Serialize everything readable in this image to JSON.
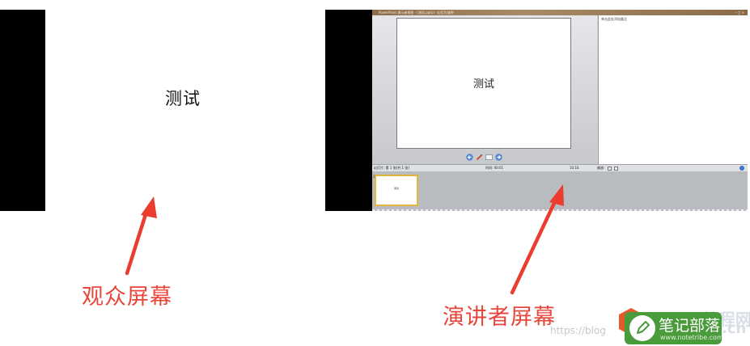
{
  "audience": {
    "slide_title": "测试",
    "caption": "观众屏幕"
  },
  "presenter": {
    "window_title": "PowerPoint 演示者视图 - [测试.pptx] - 幻灯片放映",
    "window_buttons": "– □ ×",
    "slide_title": "测试",
    "notes_text": "单击此处添加备注",
    "status": {
      "slide_label": "幻灯片: 第 1 张(共 1 张)",
      "time_label": "时间: 00:01",
      "clock": "10:16",
      "zoom_label": "缩放:"
    },
    "thumbnail": {
      "number": "1",
      "text": "测试"
    },
    "caption": "演讲者屏幕"
  },
  "watermarks": {
    "csdn": "https://blog",
    "office": "Office教程网",
    "notetribe_name": "笔记部落",
    "notetribe_url": "www.notetribe.com",
    "cn": ".cn"
  },
  "colors": {
    "caption": "#e8463b",
    "arrow": "#ea3d2f",
    "thumb_border": "#e2b53b",
    "badge": "#4a9b3c"
  }
}
